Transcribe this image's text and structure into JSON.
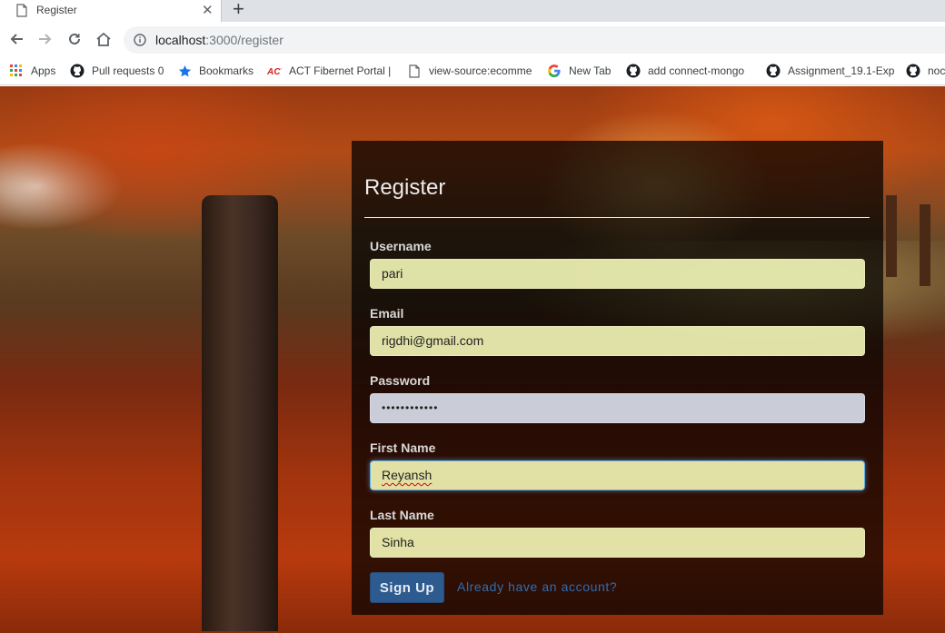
{
  "browser": {
    "tab_title": "Register",
    "new_tab_symbol": "+",
    "close_symbol": "✕",
    "url_host": "localhost",
    "url_path": ":3000/register"
  },
  "bookmarks": [
    {
      "label": "Apps",
      "icon": "apps-grid-icon"
    },
    {
      "label": "Pull requests 0",
      "icon": "github-icon"
    },
    {
      "label": "Bookmarks",
      "icon": "star-icon"
    },
    {
      "label": "ACT Fibernet Portal |",
      "icon": "act-logo-icon"
    },
    {
      "label": "view-source:ecomme",
      "icon": "page-icon"
    },
    {
      "label": "New Tab",
      "icon": "google-icon"
    },
    {
      "label": "add connect-mongo",
      "icon": "github-icon"
    },
    {
      "label": "Assignment_19.1-Exp",
      "icon": "github-icon"
    },
    {
      "label": "noc",
      "icon": "github-icon"
    }
  ],
  "form": {
    "title": "Register",
    "fields": [
      {
        "label": "Username",
        "value": "pari"
      },
      {
        "label": "Email",
        "value": "rigdhi@gmail.com"
      },
      {
        "label": "Password",
        "value": "••••••••••••"
      },
      {
        "label": "First Name",
        "value": "Reyansh"
      },
      {
        "label": "Last Name",
        "value": "Sinha"
      }
    ],
    "submit_label": "Sign Up",
    "login_link": "Already have an account?"
  },
  "colors": {
    "panel_bg": "#000000b8",
    "autofill_bg": "#faffbd",
    "button_bg": "#2e5b8f",
    "link": "#2f6db0"
  }
}
